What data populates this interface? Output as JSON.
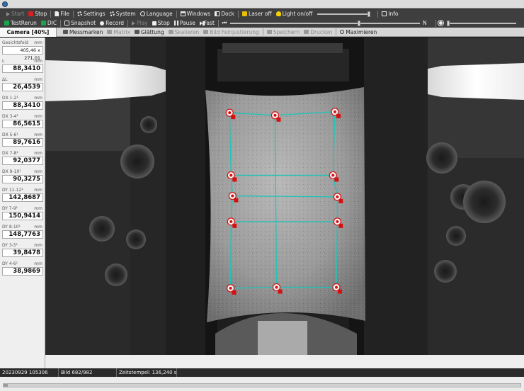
{
  "toolbar_main": {
    "start": "Start",
    "stop": "Stop",
    "file": "File",
    "settings": "Settings",
    "system": "System",
    "language": "Language",
    "windows": "Windows",
    "dock": "Dock",
    "laser": "Laser off",
    "light": "Light on/off",
    "info": "Info",
    "light_level": 0.97
  },
  "toolbar_capture": {
    "testrerun": "TestRerun",
    "dic": "DIC",
    "snapshot": "Snapshot",
    "record": "Record",
    "play": "Play",
    "stop": "Stop",
    "pause": "Pause",
    "fast": "Fast",
    "n_label": "N",
    "position": 0.68,
    "brightness": 0.02
  },
  "tabs": {
    "camera": "Camera [40%]",
    "messmarken": "Messmarken",
    "matrix": "Matrix",
    "glaettung": "Glättung",
    "skalieren": "Skalieren",
    "bild_feinjustierung": "Bild Feinjustierung",
    "speichern": "Speichern",
    "drucken": "Drucken",
    "maximieren": "Maximieren"
  },
  "measurements": [
    {
      "label": "Gesichtsfeld",
      "unit": "mm",
      "value": "405,46 x 271,01",
      "small": true
    },
    {
      "label": "L",
      "unit": "mm",
      "value": "88,3410"
    },
    {
      "label": "ΔL",
      "unit": "mm",
      "value": "26,4539"
    },
    {
      "label": "DX 1-2¹",
      "unit": "mm",
      "value": "88,3410"
    },
    {
      "label": "DX 3-4¹",
      "unit": "mm",
      "value": "86,5615"
    },
    {
      "label": "DX 5-6¹",
      "unit": "mm",
      "value": "89,7616"
    },
    {
      "label": "DX 7-8¹",
      "unit": "mm",
      "value": "92,0377"
    },
    {
      "label": "DX 9-10¹",
      "unit": "mm",
      "value": "90,3275"
    },
    {
      "label": "DY 11-12¹",
      "unit": "mm",
      "value": "142,8687"
    },
    {
      "label": "DY 7-9¹",
      "unit": "mm",
      "value": "150,9414"
    },
    {
      "label": "DY 8-10¹",
      "unit": "mm",
      "value": "148,7763"
    },
    {
      "label": "DY 3-5¹",
      "unit": "mm",
      "value": "39,8478"
    },
    {
      "label": "DY 4-6¹",
      "unit": "mm",
      "value": "38,9869"
    }
  ],
  "status": {
    "timestamp": "20230929 105306",
    "bild": "Bild 682/982",
    "zeitstempel": "Zeitstempel: 136,240 s"
  },
  "colors": {
    "grid_lines": "#1fc4b8",
    "marker_red": "#d41010",
    "marker_white": "#f4f4f4"
  },
  "markers": [
    {
      "x": 0.385,
      "y": 0.237
    },
    {
      "x": 0.48,
      "y": 0.245
    },
    {
      "x": 0.605,
      "y": 0.234
    },
    {
      "x": 0.388,
      "y": 0.434
    },
    {
      "x": 0.601,
      "y": 0.434
    },
    {
      "x": 0.391,
      "y": 0.499
    },
    {
      "x": 0.61,
      "y": 0.502
    },
    {
      "x": 0.388,
      "y": 0.58
    },
    {
      "x": 0.61,
      "y": 0.58
    },
    {
      "x": 0.387,
      "y": 0.79
    },
    {
      "x": 0.483,
      "y": 0.787
    },
    {
      "x": 0.608,
      "y": 0.787
    }
  ]
}
